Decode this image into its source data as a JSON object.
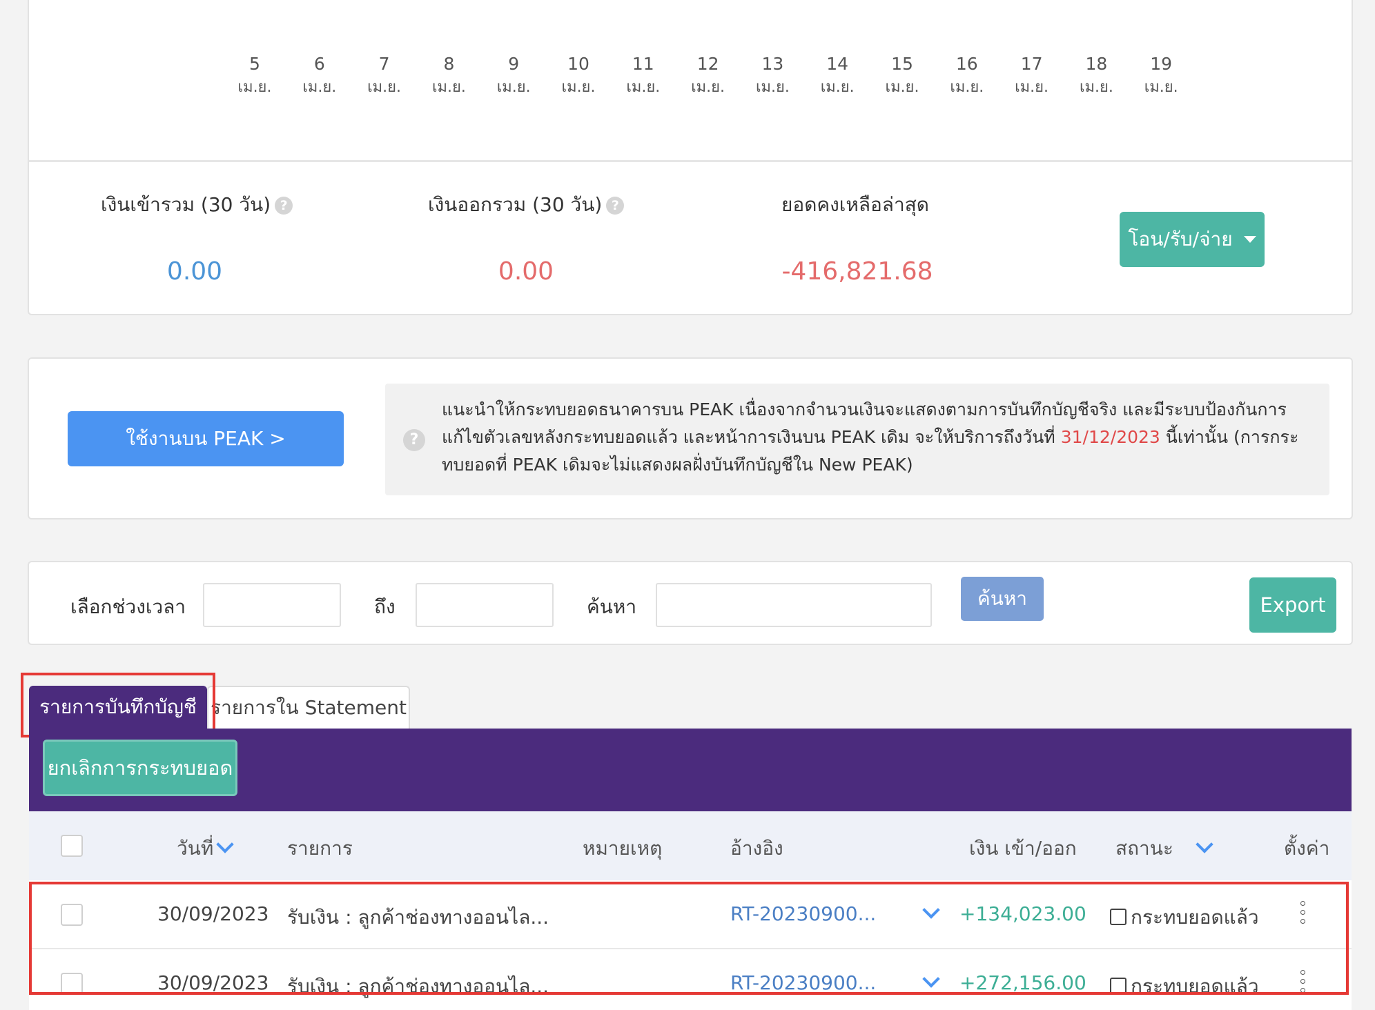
{
  "chart": {
    "dates": [
      {
        "day": "5",
        "month": "เม.ย."
      },
      {
        "day": "6",
        "month": "เม.ย."
      },
      {
        "day": "7",
        "month": "เม.ย."
      },
      {
        "day": "8",
        "month": "เม.ย."
      },
      {
        "day": "9",
        "month": "เม.ย."
      },
      {
        "day": "10",
        "month": "เม.ย."
      },
      {
        "day": "11",
        "month": "เม.ย."
      },
      {
        "day": "12",
        "month": "เม.ย."
      },
      {
        "day": "13",
        "month": "เม.ย."
      },
      {
        "day": "14",
        "month": "เม.ย."
      },
      {
        "day": "15",
        "month": "เม.ย."
      },
      {
        "day": "16",
        "month": "เม.ย."
      },
      {
        "day": "17",
        "month": "เม.ย."
      },
      {
        "day": "18",
        "month": "เม.ย."
      },
      {
        "day": "19",
        "month": "เม.ย."
      }
    ]
  },
  "summary": {
    "income_label": "เงินเข้ารวม (30 วัน)",
    "income_value": "0.00",
    "expense_label": "เงินออกรวม (30 วัน)",
    "expense_value": "0.00",
    "balance_label": "ยอดคงเหลือล่าสุด",
    "balance_value": "-416,821.68",
    "transfer_button": "โอน/รับ/จ่าย",
    "help_glyph": "?",
    "colors": {
      "income": "#4b94d6",
      "expense": "#e46b6b",
      "balance": "#e46b6b"
    }
  },
  "notice": {
    "peak_button": "ใช้งานบน PEAK >",
    "text_before": "แนะนำให้กระทบยอดธนาคารบน PEAK เนื่องจากจำนวนเงินจะแสดงตามการบันทึกบัญชีจริง และมีระบบป้องกันการแก้ไขตัวเลขหลังกระทบยอดแล้ว และหน้าการเงินบน PEAK เดิม จะให้บริการถึงวันที่ ",
    "date": "31/12/2023",
    "text_after": " นี้เท่านั้น (การกระทบยอดที่ PEAK เดิมจะไม่แสดงผลฝั่งบันทึกบัญชีใน New PEAK)"
  },
  "filter": {
    "period_label": "เลือกช่วงเวลา",
    "to_label": "ถึง",
    "search_label": "ค้นหา",
    "from_value": "",
    "to_value": "",
    "search_value": "",
    "search_button": "ค้นหา",
    "export_button": "Export"
  },
  "tabs": {
    "ledger": "รายการบันทึกบัญชี",
    "statement": "รายการใน Statement"
  },
  "actions": {
    "cancel_reconcile": "ยกเลิกการกระทบยอด"
  },
  "table": {
    "headers": {
      "date": "วันที่",
      "item": "รายการ",
      "note": "หมายเหตุ",
      "ref": "อ้างอิง",
      "amount": "เงิน เข้า/ออก",
      "status": "สถานะ",
      "settings": "ตั้งค่า"
    },
    "rows": [
      {
        "date": "30/09/2023",
        "item": "รับเงิน : ลูกค้าช่องทางออนไล...",
        "ref": "RT-20230900...",
        "amount": "+134,023.00",
        "status": "กระทบยอดแล้ว"
      },
      {
        "date": "30/09/2023",
        "item": "รับเงิน : ลูกค้าช่องทางออนไล...",
        "ref": "RT-20230900...",
        "amount": "+272,156.00",
        "status": "กระทบยอดแล้ว"
      }
    ]
  }
}
